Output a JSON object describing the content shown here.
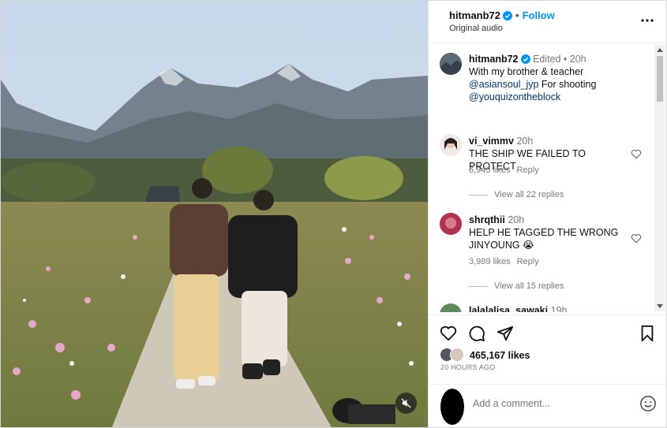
{
  "post": {
    "username": "hitmanb72",
    "follow_label": "Follow",
    "audio": "Original audio",
    "caption": {
      "edited": "Edited",
      "age": "20h",
      "line1": "With my brother & teacher",
      "mention1": "@asiansoul_jyp",
      "after_mention1": "For shooting",
      "mention2": "@youquizontheblock"
    }
  },
  "comments": [
    {
      "username": "vi_vimmv",
      "age": "20h",
      "text": "THE SHIP WE FAILED TO PROTECT",
      "likes": "6,943 likes",
      "reply": "Reply",
      "view_replies": "View all 22 replies"
    },
    {
      "username": "shrqthii",
      "age": "20h",
      "text_line1": "HELP HE TAGGED THE WRONG",
      "text_line2": "JINYOUNG 😭",
      "likes": "3,989 likes",
      "reply": "Reply",
      "view_replies": "View all 15 replies"
    },
    {
      "username": "lalalalisa_sawaki",
      "age": "19h"
    }
  ],
  "actions": {
    "like_count": "465,167 likes",
    "timestamp": "20 HOURS AGO",
    "add_comment_placeholder": "Add a comment..."
  },
  "colors": {
    "accent": "#0095f6",
    "link": "#00376b"
  },
  "icons": [
    "verified-badge-icon",
    "more-options-icon",
    "heart-icon",
    "comment-icon",
    "share-icon",
    "bookmark-icon",
    "emoji-icon",
    "mute-icon"
  ]
}
